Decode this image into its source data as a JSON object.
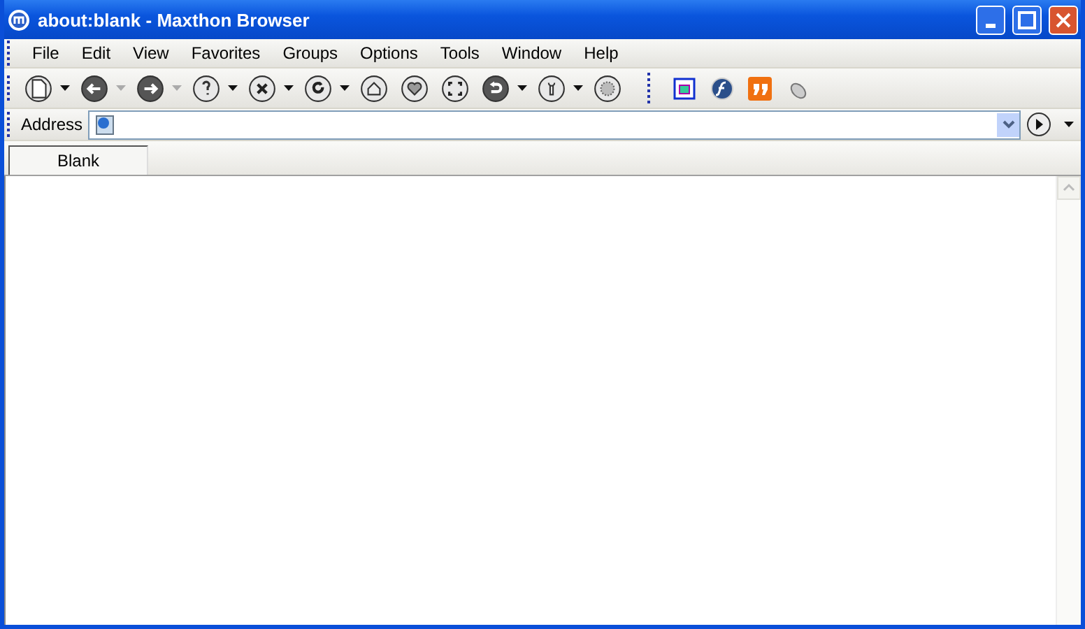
{
  "window": {
    "title": "about:blank - Maxthon Browser"
  },
  "menu": [
    "File",
    "Edit",
    "View",
    "Favorites",
    "Groups",
    "Options",
    "Tools",
    "Window",
    "Help"
  ],
  "toolbar": [
    {
      "kind": "dropdown",
      "disabled": false
    },
    {
      "kind": "dropdown",
      "disabled": true
    },
    {
      "kind": "dropdown",
      "disabled": true
    },
    {
      "kind": "dropdown",
      "disabled": false
    },
    {
      "kind": "dropdown",
      "disabled": false
    },
    {
      "kind": "dropdown",
      "disabled": false
    },
    {
      "kind": "plain"
    },
    {
      "kind": "plain"
    },
    {
      "kind": "plain"
    },
    {
      "kind": "dropdown",
      "disabled": false
    },
    {
      "kind": "dropdown",
      "disabled": false
    },
    {
      "kind": "plain"
    }
  ],
  "address": {
    "label": "Address"
  },
  "tabs": [
    {
      "label": "Blank",
      "selected": true
    }
  ]
}
